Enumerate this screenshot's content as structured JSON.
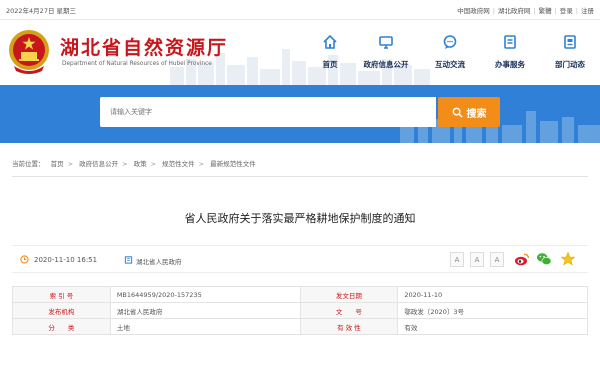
{
  "topbar": {
    "date": "2022年4月27日 星期三",
    "links": [
      "中国政府网",
      "湖北政府网",
      "繁體",
      "登录",
      "注册"
    ]
  },
  "header": {
    "title": "湖北省自然资源厅",
    "subtitle": "Department of Natural Resources of Hubei Province",
    "nav": [
      {
        "label": "首页",
        "icon": "home-icon"
      },
      {
        "label": "政府信息公开",
        "icon": "monitor-icon"
      },
      {
        "label": "互动交流",
        "icon": "chat-icon"
      },
      {
        "label": "办事服务",
        "icon": "document-icon"
      },
      {
        "label": "部门动态",
        "icon": "news-icon"
      }
    ]
  },
  "search": {
    "placeholder": "请输入关键字",
    "button_label": "搜索"
  },
  "breadcrumb": {
    "prefix": "当前位置：",
    "items": [
      "首页",
      "政府信息公开",
      "政策",
      "规范性文件",
      "最新规范性文件"
    ]
  },
  "article": {
    "title": "省人民政府关于落实最严格耕地保护制度的通知",
    "datetime": "2020-11-10 16:51",
    "source": "湖北省人民政府",
    "font_sizes": [
      "A",
      "A",
      "A"
    ]
  },
  "info_table": {
    "rows": [
      {
        "k1": "索 引 号",
        "v1": "MB1644959/2020-157235",
        "k2": "发文日期",
        "v2": "2020-11-10"
      },
      {
        "k1": "发布机构",
        "v1": "湖北省人民政府",
        "k2": "文　　号",
        "v2": "鄂政发〔2020〕3号"
      },
      {
        "k1": "分　　类",
        "v1": "土地",
        "k2": "有 效 性",
        "v2": "有效"
      }
    ]
  },
  "colors": {
    "brand_red": "#c8161d",
    "band_blue": "#2f80d6",
    "search_orange": "#f38d1a",
    "nav_blue": "#1a2f5a"
  }
}
